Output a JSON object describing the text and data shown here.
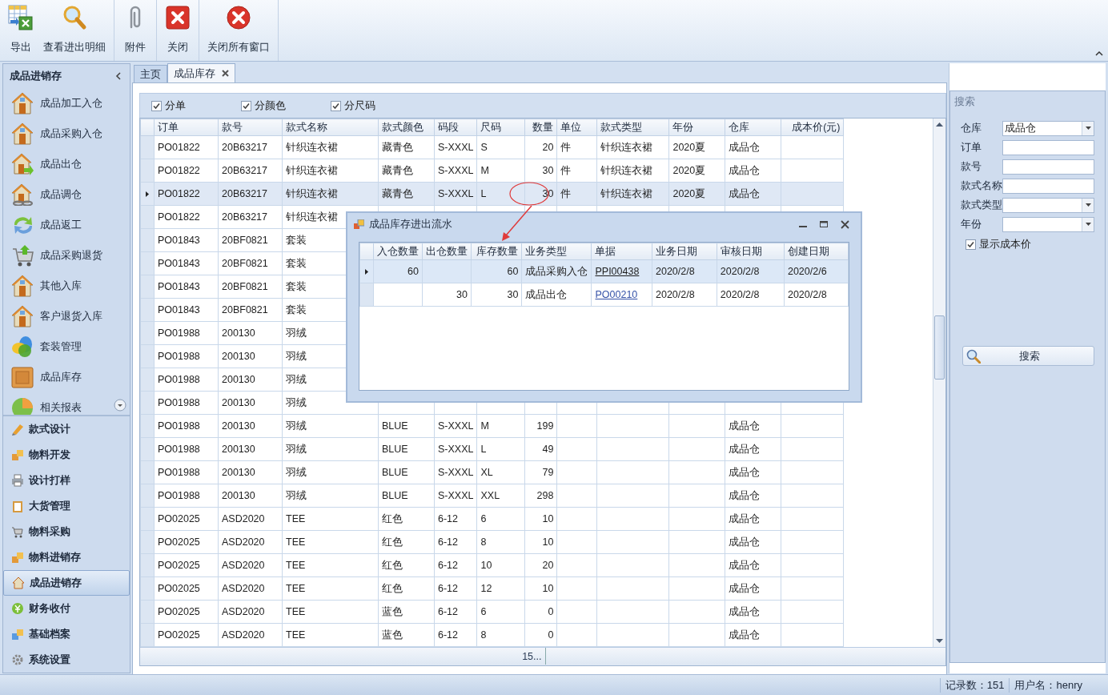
{
  "toolbar": {
    "groups": [
      [
        "导出",
        "查看进出明细"
      ],
      [
        "附件"
      ],
      [
        "关闭"
      ],
      [
        "关闭所有窗口"
      ]
    ]
  },
  "sidebar": {
    "title": "成品进销存",
    "items": [
      "成品加工入仓",
      "成品采购入仓",
      "成品出仓",
      "成品调仓",
      "成品返工",
      "成品采购退货",
      "其他入库",
      "客户退货入库",
      "套装管理",
      "成品库存",
      "相关报表"
    ],
    "modules": [
      {
        "label": "款式设计",
        "selected": false
      },
      {
        "label": "物料开发",
        "selected": false
      },
      {
        "label": "设计打样",
        "selected": false
      },
      {
        "label": "大货管理",
        "selected": false
      },
      {
        "label": "物料采购",
        "selected": false
      },
      {
        "label": "物料进销存",
        "selected": false
      },
      {
        "label": "成品进销存",
        "selected": true
      },
      {
        "label": "财务收付",
        "selected": false
      },
      {
        "label": "基础档案",
        "selected": false
      },
      {
        "label": "系统设置",
        "selected": false
      }
    ]
  },
  "tabs": [
    {
      "label": "主页",
      "selected": false
    },
    {
      "label": "成品库存",
      "selected": true
    }
  ],
  "filters": [
    {
      "label": "分单",
      "checked": true
    },
    {
      "label": "分颜色",
      "checked": true
    },
    {
      "label": "分尺码",
      "checked": true
    }
  ],
  "table": {
    "columns": [
      "订单",
      "款号",
      "款式名称",
      "款式颜色",
      "码段",
      "尺码",
      "数量",
      "单位",
      "款式类型",
      "年份",
      "仓库",
      "成本价(元)"
    ],
    "rows": [
      {
        "selected": false,
        "cells": [
          "PO01822",
          "20B63217",
          "针织连衣裙",
          "藏青色",
          "S-XXXL",
          "S",
          "20",
          "件",
          "针织连衣裙",
          "2020夏",
          "成品仓"
        ]
      },
      {
        "selected": false,
        "cells": [
          "PO01822",
          "20B63217",
          "针织连衣裙",
          "藏青色",
          "S-XXXL",
          "M",
          "30",
          "件",
          "针织连衣裙",
          "2020夏",
          "成品仓"
        ]
      },
      {
        "selected": true,
        "cells": [
          "PO01822",
          "20B63217",
          "针织连衣裙",
          "藏青色",
          "S-XXXL",
          "L",
          "30",
          "件",
          "针织连衣裙",
          "2020夏",
          "成品仓"
        ]
      },
      {
        "selected": false,
        "cells": [
          "PO01822",
          "20B63217",
          "针织连衣裙"
        ]
      },
      {
        "selected": false,
        "cells": [
          "PO01843",
          "20BF0821",
          "套装"
        ]
      },
      {
        "selected": false,
        "cells": [
          "PO01843",
          "20BF0821",
          "套装"
        ]
      },
      {
        "selected": false,
        "cells": [
          "PO01843",
          "20BF0821",
          "套装"
        ]
      },
      {
        "selected": false,
        "cells": [
          "PO01843",
          "20BF0821",
          "套装"
        ]
      },
      {
        "selected": false,
        "cells": [
          "PO01988",
          "200130",
          "羽绒"
        ]
      },
      {
        "selected": false,
        "cells": [
          "PO01988",
          "200130",
          "羽绒"
        ]
      },
      {
        "selected": false,
        "cells": [
          "PO01988",
          "200130",
          "羽绒"
        ]
      },
      {
        "selected": false,
        "cells": [
          "PO01988",
          "200130",
          "羽绒"
        ]
      },
      {
        "selected": false,
        "cells": [
          "PO01988",
          "200130",
          "羽绒",
          "BLUE",
          "S-XXXL",
          "M",
          "199",
          null,
          null,
          null,
          "成品仓"
        ]
      },
      {
        "selected": false,
        "cells": [
          "PO01988",
          "200130",
          "羽绒",
          "BLUE",
          "S-XXXL",
          "L",
          "49",
          null,
          null,
          null,
          "成品仓"
        ]
      },
      {
        "selected": false,
        "cells": [
          "PO01988",
          "200130",
          "羽绒",
          "BLUE",
          "S-XXXL",
          "XL",
          "79",
          null,
          null,
          null,
          "成品仓"
        ]
      },
      {
        "selected": false,
        "cells": [
          "PO01988",
          "200130",
          "羽绒",
          "BLUE",
          "S-XXXL",
          "XXL",
          "298",
          null,
          null,
          null,
          "成品仓"
        ]
      },
      {
        "selected": false,
        "cells": [
          "PO02025",
          "ASD2020",
          "TEE",
          "红色",
          "6-12",
          "6",
          "10",
          null,
          null,
          null,
          "成品仓"
        ]
      },
      {
        "selected": false,
        "cells": [
          "PO02025",
          "ASD2020",
          "TEE",
          "红色",
          "6-12",
          "8",
          "10",
          null,
          null,
          null,
          "成品仓"
        ]
      },
      {
        "selected": false,
        "cells": [
          "PO02025",
          "ASD2020",
          "TEE",
          "红色",
          "6-12",
          "10",
          "20",
          null,
          null,
          null,
          "成品仓"
        ]
      },
      {
        "selected": false,
        "cells": [
          "PO02025",
          "ASD2020",
          "TEE",
          "红色",
          "6-12",
          "12",
          "10",
          null,
          null,
          null,
          "成品仓"
        ]
      },
      {
        "selected": false,
        "cells": [
          "PO02025",
          "ASD2020",
          "TEE",
          "蓝色",
          "6-12",
          "6",
          "0",
          null,
          null,
          null,
          "成品仓"
        ]
      },
      {
        "selected": false,
        "cells": [
          "PO02025",
          "ASD2020",
          "TEE",
          "蓝色",
          "6-12",
          "8",
          "0",
          null,
          null,
          null,
          "成品仓"
        ]
      }
    ],
    "footer": "15..."
  },
  "popup": {
    "title": "成品库存进出流水",
    "columns": [
      "入仓数量",
      "出仓数量",
      "库存数量",
      "业务类型",
      "单据",
      "业务日期",
      "审核日期",
      "创建日期"
    ],
    "rows": [
      {
        "selected": true,
        "cells": [
          "60",
          null,
          "60",
          "成品采购入仓",
          "PPI00438",
          "2020/2/8",
          "2020/2/8",
          "2020/2/6"
        ]
      },
      {
        "selected": false,
        "cells": [
          null,
          "30",
          "30",
          "成品出仓",
          "PO00210",
          "2020/2/8",
          "2020/2/8",
          "2020/2/8"
        ]
      }
    ]
  },
  "search_panel": {
    "title": "搜索",
    "fields": [
      {
        "label": "仓库",
        "kind": "dropdown",
        "value": "成品仓"
      },
      {
        "label": "订单",
        "kind": "text"
      },
      {
        "label": "款号",
        "kind": "text"
      },
      {
        "label": "款式名称",
        "kind": "text"
      },
      {
        "label": "款式类型",
        "kind": "dropdown"
      },
      {
        "label": "年份",
        "kind": "dropdown"
      }
    ],
    "show_cost": {
      "label": "显示成本价",
      "checked": true
    },
    "button": "搜索"
  },
  "status_bar": {
    "record_count": "记录数：151",
    "user": "用户名：henry"
  }
}
